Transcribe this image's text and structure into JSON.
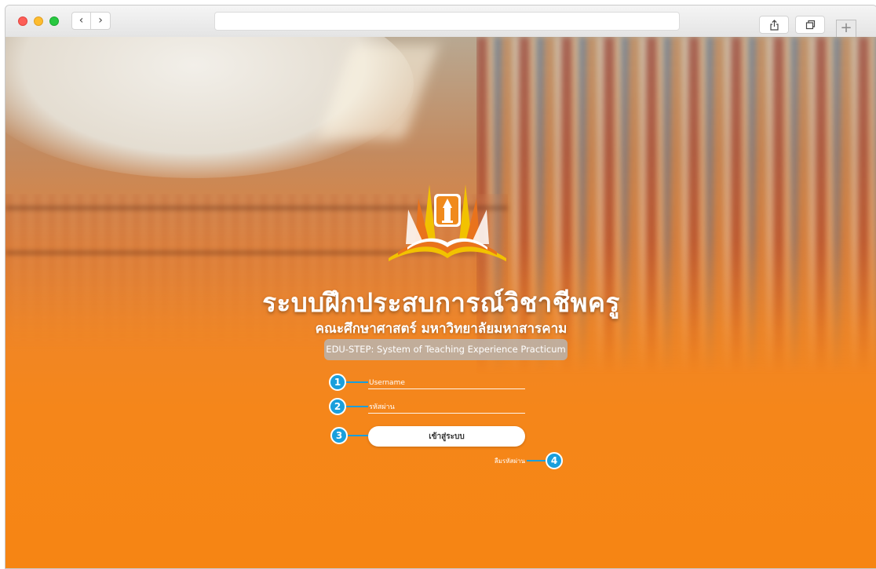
{
  "browser": {
    "back_glyph": "‹",
    "forward_glyph": "›",
    "new_tab_glyph": "+",
    "icons": [
      "share-icon",
      "tabs-icon"
    ]
  },
  "header": {
    "title": "ระบบฝึกประสบการณ์วิชาชีพครู",
    "subtitle": "คณะศึกษาศาสตร์ มหาวิทยาลัยมหาสารคาม",
    "system_name": "EDU-STEP: System of Teaching Experience Practicum"
  },
  "login": {
    "username_placeholder": "Username",
    "password_placeholder": "รหัสผ่าน",
    "submit_label": "เข้าสู่ระบบ",
    "forgot_label": "ลืมรหัสผ่าน"
  },
  "callouts": [
    "1",
    "2",
    "3",
    "4"
  ],
  "colors": {
    "accent_orange": "#f5861a",
    "callout_blue": "#1a9fdc",
    "logo_gold": "#f2c200",
    "logo_orange": "#e9731c"
  }
}
